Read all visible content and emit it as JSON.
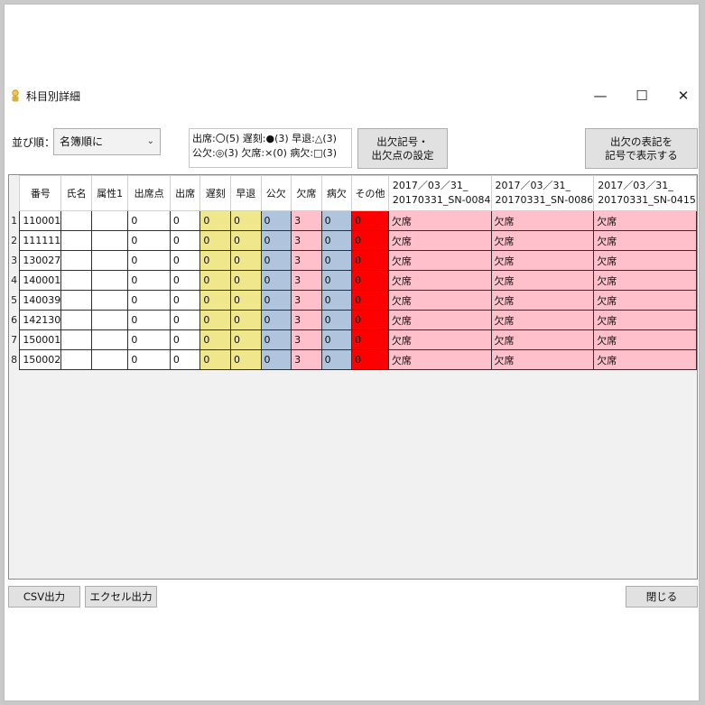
{
  "window": {
    "title": "科目別詳細",
    "min_glyph": "—",
    "max_glyph": "☐",
    "close_glyph": "✕"
  },
  "toolbar": {
    "sort_label": "並び順：",
    "sort_value": "名簿順に",
    "legend_line1": "出席:〇(5)  遅刻:●(3)  早退:△(3)",
    "legend_line2": "公欠:◎(3)  欠席:×(0)  病欠:□(3)",
    "settings_button": "出欠記号・\n出欠点の設定",
    "display_button": "出欠の表記を\n記号で表示する"
  },
  "grid": {
    "columns": [
      "番号",
      "氏名",
      "属性1",
      "出席点",
      "出席",
      "遅刻",
      "早退",
      "公欠",
      "欠席",
      "病欠",
      "その他",
      "2017／03／31_\n20170331_SN-0084",
      "2017／03／31_\n20170331_SN-0086",
      "2017／03／31_\n20170331_SN-0415"
    ],
    "rows": [
      {
        "n": "1",
        "cells": [
          "110001",
          "",
          "",
          "0",
          "0",
          "0",
          "0",
          "0",
          "3",
          "0",
          "0",
          "欠席",
          "欠席",
          "欠席"
        ]
      },
      {
        "n": "2",
        "cells": [
          "111111",
          "",
          "",
          "0",
          "0",
          "0",
          "0",
          "0",
          "3",
          "0",
          "0",
          "欠席",
          "欠席",
          "欠席"
        ]
      },
      {
        "n": "3",
        "cells": [
          "130027",
          "",
          "",
          "0",
          "0",
          "0",
          "0",
          "0",
          "3",
          "0",
          "0",
          "欠席",
          "欠席",
          "欠席"
        ]
      },
      {
        "n": "4",
        "cells": [
          "140001",
          "",
          "",
          "0",
          "0",
          "0",
          "0",
          "0",
          "3",
          "0",
          "0",
          "欠席",
          "欠席",
          "欠席"
        ]
      },
      {
        "n": "5",
        "cells": [
          "140039",
          "",
          "",
          "0",
          "0",
          "0",
          "0",
          "0",
          "3",
          "0",
          "0",
          "欠席",
          "欠席",
          "欠席"
        ]
      },
      {
        "n": "6",
        "cells": [
          "142130",
          "",
          "",
          "0",
          "0",
          "0",
          "0",
          "0",
          "3",
          "0",
          "0",
          "欠席",
          "欠席",
          "欠席"
        ]
      },
      {
        "n": "7",
        "cells": [
          "150001",
          "",
          "",
          "0",
          "0",
          "0",
          "0",
          "0",
          "3",
          "0",
          "0",
          "欠席",
          "欠席",
          "欠席"
        ]
      },
      {
        "n": "8",
        "cells": [
          "150002",
          "",
          "",
          "0",
          "0",
          "0",
          "0",
          "0",
          "3",
          "0",
          "0",
          "欠席",
          "欠席",
          "欠席"
        ]
      }
    ],
    "column_colors": [
      "",
      "",
      "",
      "",
      "",
      "yellow",
      "yellow",
      "blue",
      "pink",
      "blue",
      "red",
      "pink",
      "pink",
      "pink"
    ]
  },
  "colors": {
    "yellow": "#f0e68c",
    "blue": "#b0c4de",
    "pink": "#ffc0cb",
    "red": "#ff0000"
  },
  "footer": {
    "csv_button": "CSV出力",
    "excel_button": "エクセル出力",
    "close_button": "閉じる"
  }
}
